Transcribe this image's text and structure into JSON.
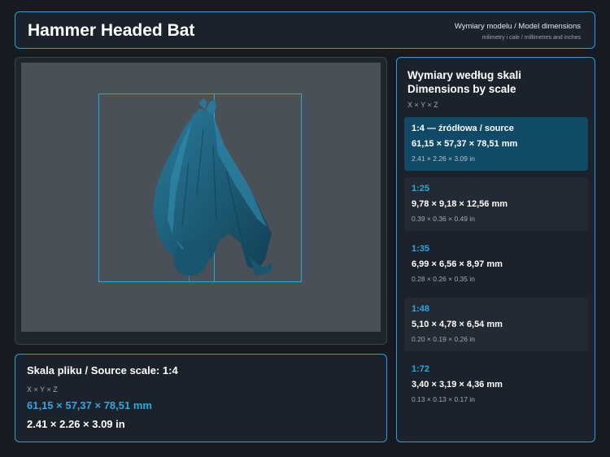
{
  "header": {
    "title": "Hammer Headed Bat",
    "subtitle": "Wymiary modelu / Model dimensions",
    "units_note": "milimetry i cale / millimetres and inches"
  },
  "source": {
    "title": "Skala pliku / Source scale: 1:4",
    "axes": "X × Y × Z",
    "mm": "61,15 × 57,37 × 78,51 mm",
    "inches": "2.41 × 2.26 × 3.09 in"
  },
  "scales": {
    "title_pl": "Wymiary według skali",
    "title_en": "Dimensions by scale",
    "axes": "X × Y × Z",
    "items": [
      {
        "label": "1:4  —  źródłowa / source",
        "mm": "61,15 × 57,37 × 78,51 mm",
        "inches": "2.41 × 2.26 × 3.09 in",
        "active": true
      },
      {
        "label": "1:25",
        "mm": "9,78 × 9,18 × 12,56 mm",
        "inches": "0.39 × 0.36 × 0.49 in"
      },
      {
        "label": "1:35",
        "mm": "6,99 × 6,56 × 8,97 mm",
        "inches": "0.28 × 0.26 × 0.35 in"
      },
      {
        "label": "1:48",
        "mm": "5,10 × 4,78 × 6,54 mm",
        "inches": "0.20 × 0.19 × 0.26 in"
      },
      {
        "label": "1:72",
        "mm": "3,40 × 3,19 × 4,36 mm",
        "inches": "0.13 × 0.13 × 0.17 in"
      }
    ]
  },
  "colors": {
    "accent": "#2ba8e0",
    "panel_border": "#2a9fd6",
    "background": "#161b22",
    "active_card": "#114a66",
    "model": "#1f5e78"
  }
}
